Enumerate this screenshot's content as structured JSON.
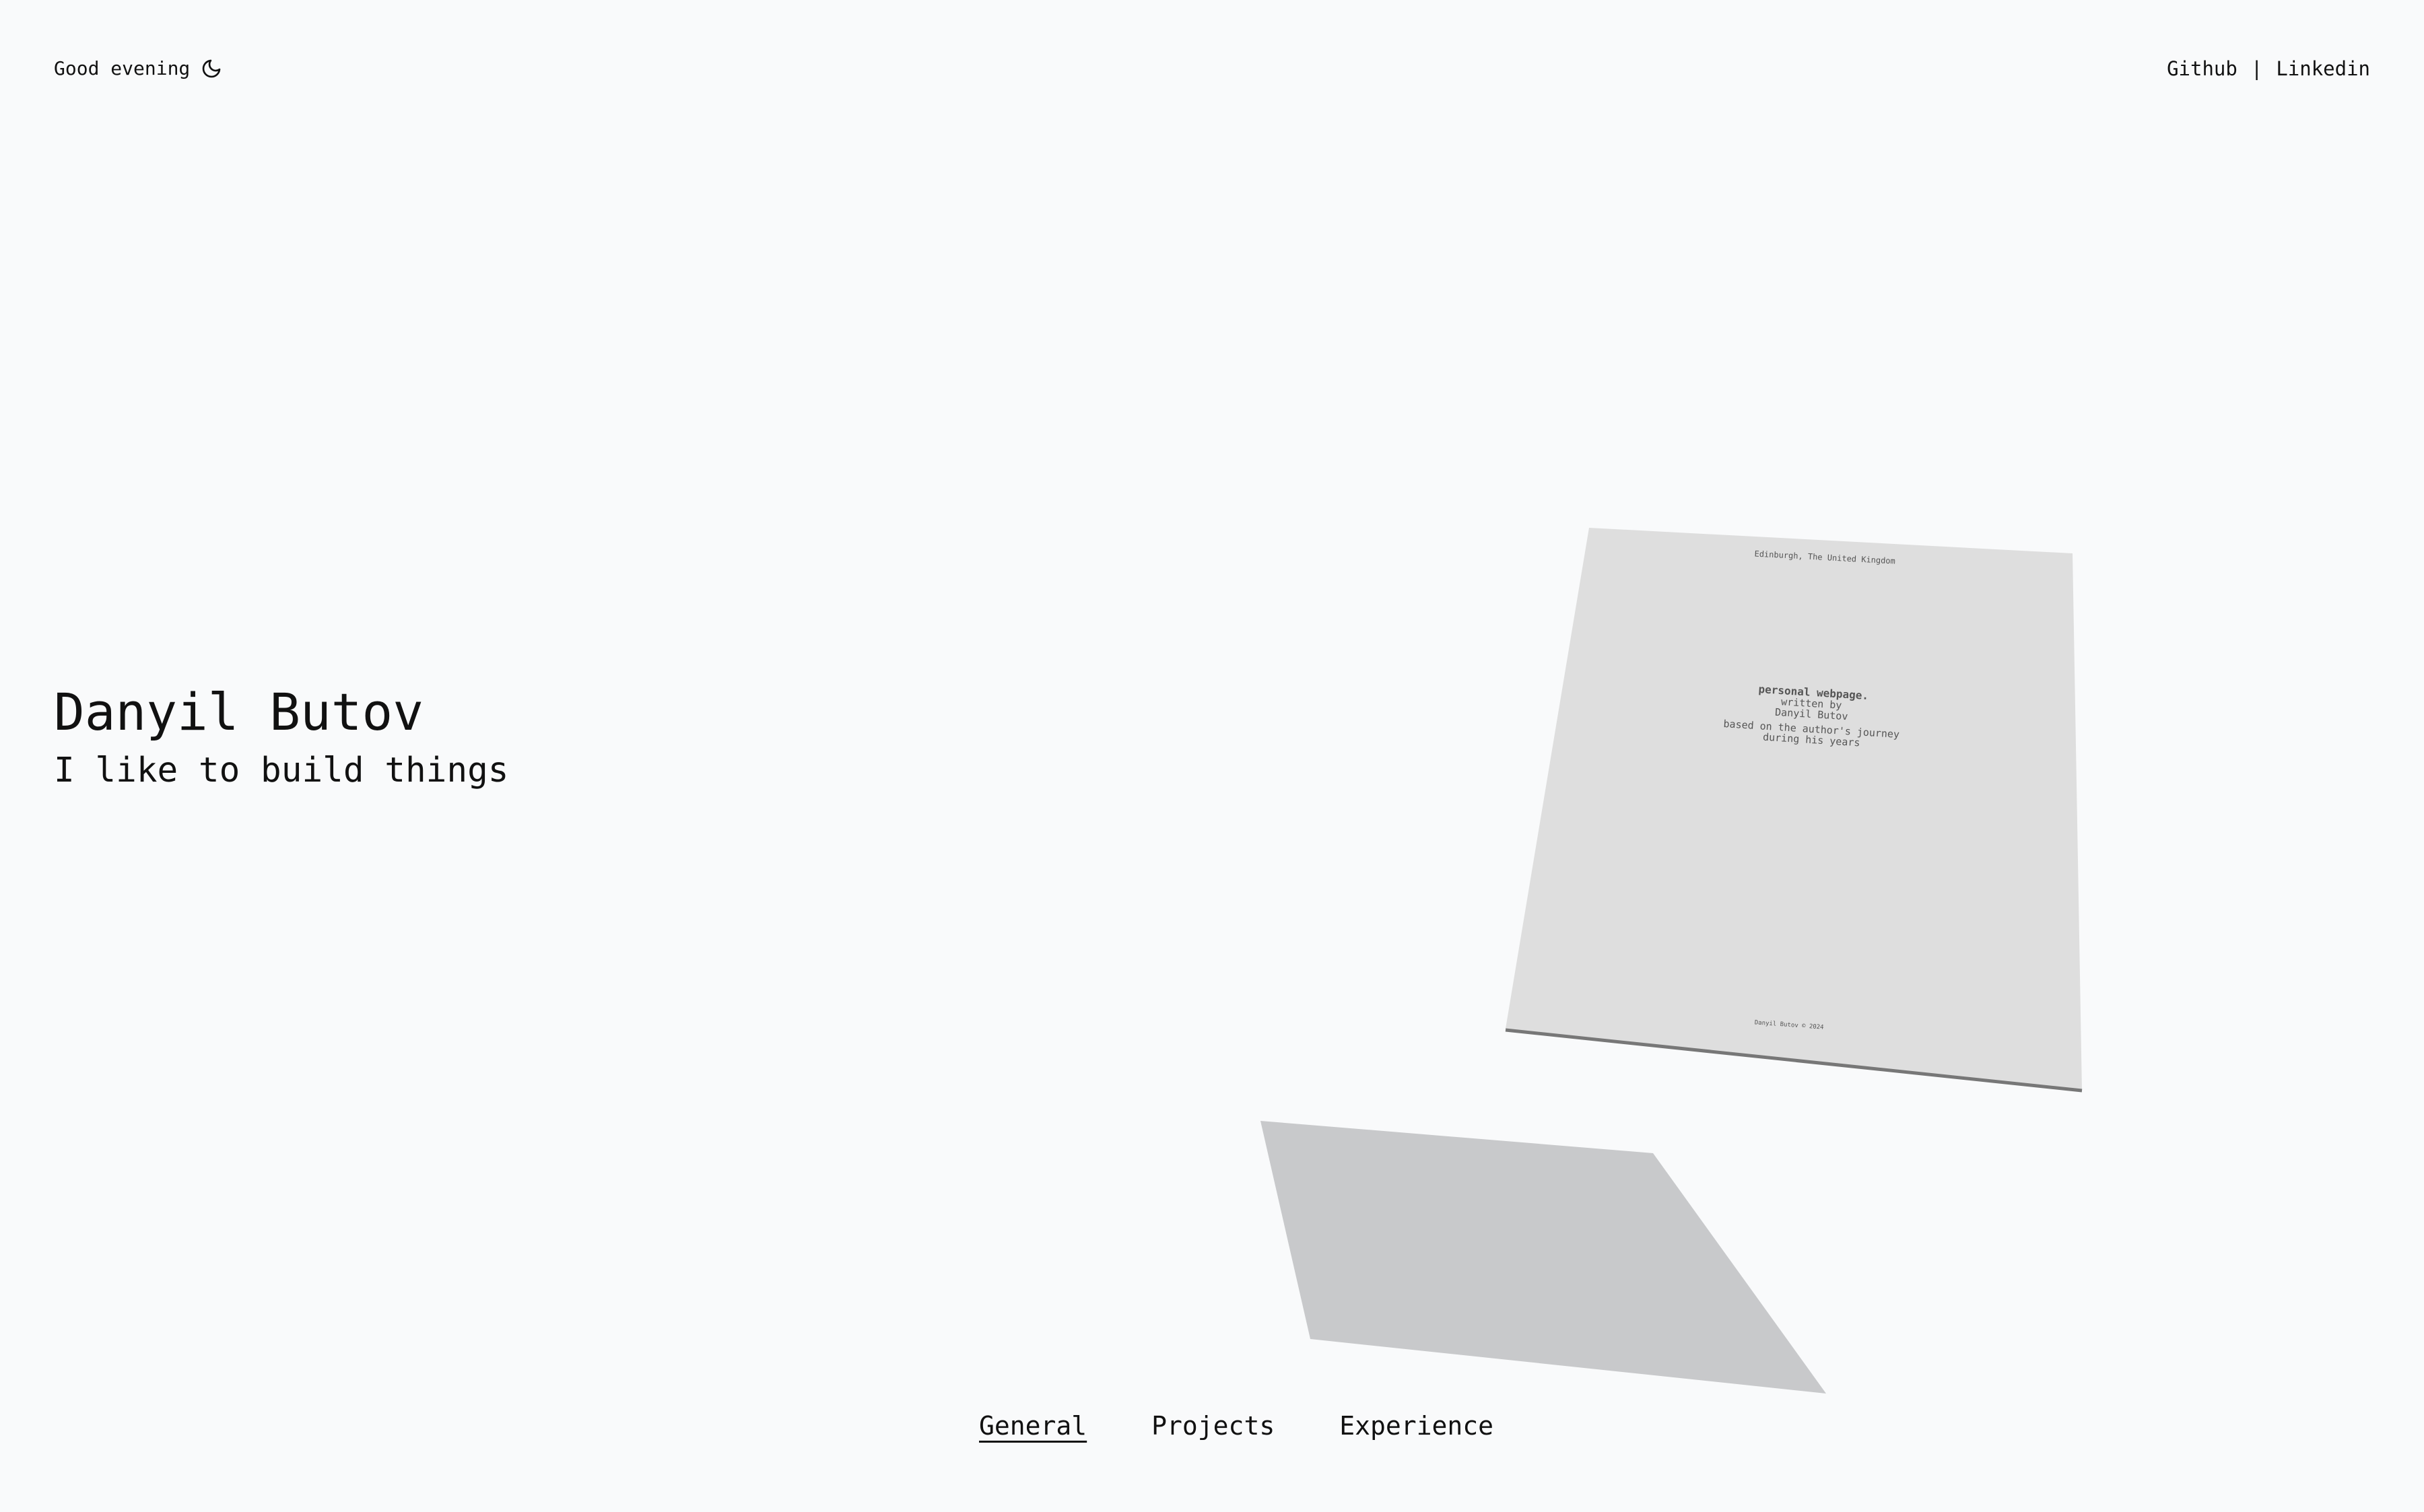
{
  "header": {
    "greeting": "Good evening",
    "greeting_icon": "moon-icon",
    "links": {
      "github": "Github",
      "separator": "|",
      "linkedin": "Linkedin"
    }
  },
  "hero": {
    "name": "Danyil Butov",
    "tagline": "I like to build things"
  },
  "paper": {
    "location": "Edinburgh, The United Kingdom",
    "title": "personal webpage.",
    "written_by": "written by",
    "author": "Danyil Butov",
    "based_on_line1": "based on the author's journey",
    "based_on_line2": "during his years",
    "footer": "Danyil Butov © 2024"
  },
  "nav": {
    "tabs": [
      {
        "label": "General",
        "active": true
      },
      {
        "label": "Projects",
        "active": false
      },
      {
        "label": "Experience",
        "active": false
      }
    ]
  },
  "colors": {
    "background": "#f9fafb",
    "text": "#111111",
    "paper": "#dedede",
    "paper_edge": "#777777",
    "shadow": "#c8c9cb"
  }
}
